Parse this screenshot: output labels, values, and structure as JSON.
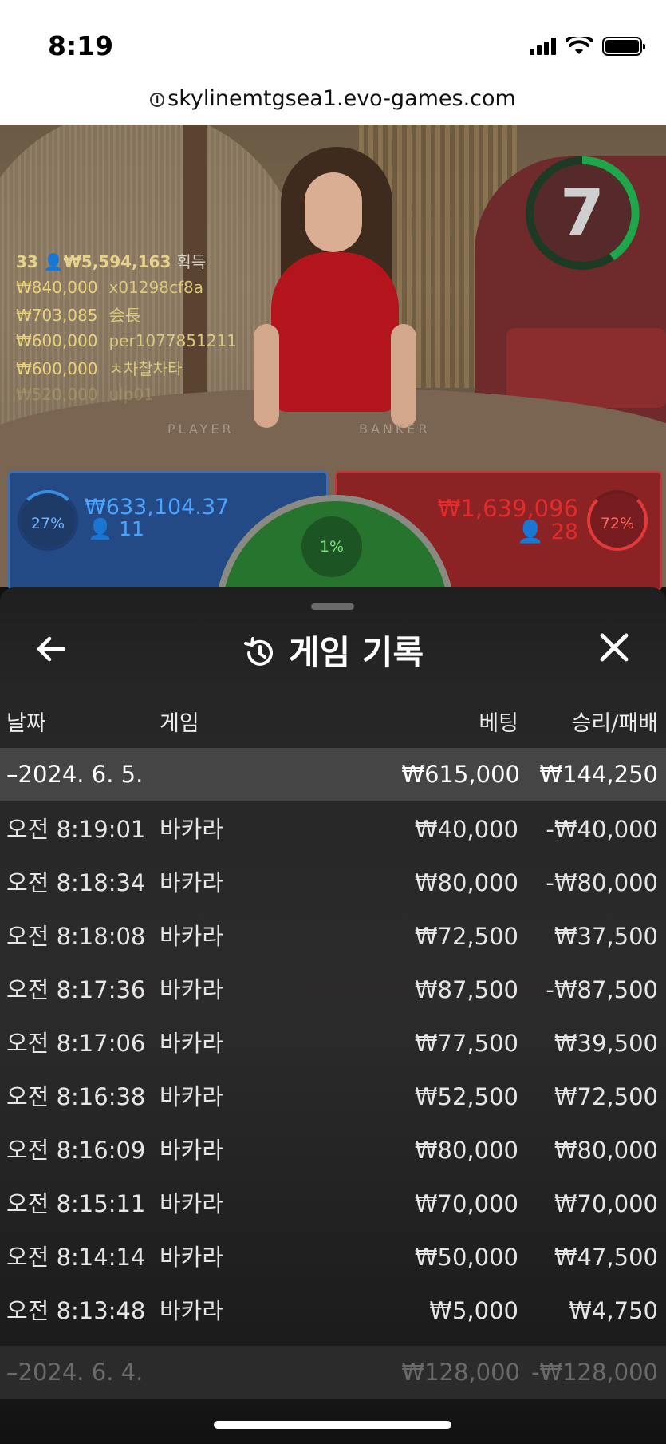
{
  "status_bar": {
    "time": "8:19"
  },
  "browser": {
    "url": "skylinemtgsea1.evo-games.com"
  },
  "video": {
    "timer": "7",
    "table_labels": {
      "player": "PLAYER",
      "banker": "BANKER"
    },
    "winners": {
      "count": "33",
      "total": "₩5,594,163",
      "label": "획득",
      "list": [
        {
          "amount": "₩840,000",
          "name": "x01298cf8a"
        },
        {
          "amount": "₩703,085",
          "name": "会長"
        },
        {
          "amount": "₩600,000",
          "name": "per1077851211"
        },
        {
          "amount": "₩600,000",
          "name": "ㅊ차찰차타"
        },
        {
          "amount": "₩520,000",
          "name": "ulp01"
        }
      ]
    }
  },
  "bets": {
    "player": {
      "percent": "27%",
      "amount": "₩633,104.37",
      "players": "11"
    },
    "tie": {
      "percent": "1%"
    },
    "banker": {
      "percent": "72%",
      "amount": "₩1,639,096",
      "players": "28"
    }
  },
  "history": {
    "title": "게임 기록",
    "columns": {
      "date": "날짜",
      "game": "게임",
      "bet": "베팅",
      "result": "승리/패배"
    },
    "day1": {
      "date": "–2024. 6. 5.",
      "bet": "₩615,000",
      "result": "₩144,250"
    },
    "rows": [
      {
        "time": "오전 8:19:01",
        "game": "바카라",
        "bet": "₩40,000",
        "result": "-₩40,000"
      },
      {
        "time": "오전 8:18:34",
        "game": "바카라",
        "bet": "₩80,000",
        "result": "-₩80,000"
      },
      {
        "time": "오전 8:18:08",
        "game": "바카라",
        "bet": "₩72,500",
        "result": "₩37,500"
      },
      {
        "time": "오전 8:17:36",
        "game": "바카라",
        "bet": "₩87,500",
        "result": "-₩87,500"
      },
      {
        "time": "오전 8:17:06",
        "game": "바카라",
        "bet": "₩77,500",
        "result": "₩39,500"
      },
      {
        "time": "오전 8:16:38",
        "game": "바카라",
        "bet": "₩52,500",
        "result": "₩72,500"
      },
      {
        "time": "오전 8:16:09",
        "game": "바카라",
        "bet": "₩80,000",
        "result": "₩80,000"
      },
      {
        "time": "오전 8:15:11",
        "game": "바카라",
        "bet": "₩70,000",
        "result": "₩70,000"
      },
      {
        "time": "오전 8:14:14",
        "game": "바카라",
        "bet": "₩50,000",
        "result": "₩47,500"
      },
      {
        "time": "오전 8:13:48",
        "game": "바카라",
        "bet": "₩5,000",
        "result": "₩4,750"
      }
    ],
    "day2": {
      "date": "–2024. 6. 4.",
      "bet": "₩128,000",
      "result": "-₩128,000"
    }
  }
}
